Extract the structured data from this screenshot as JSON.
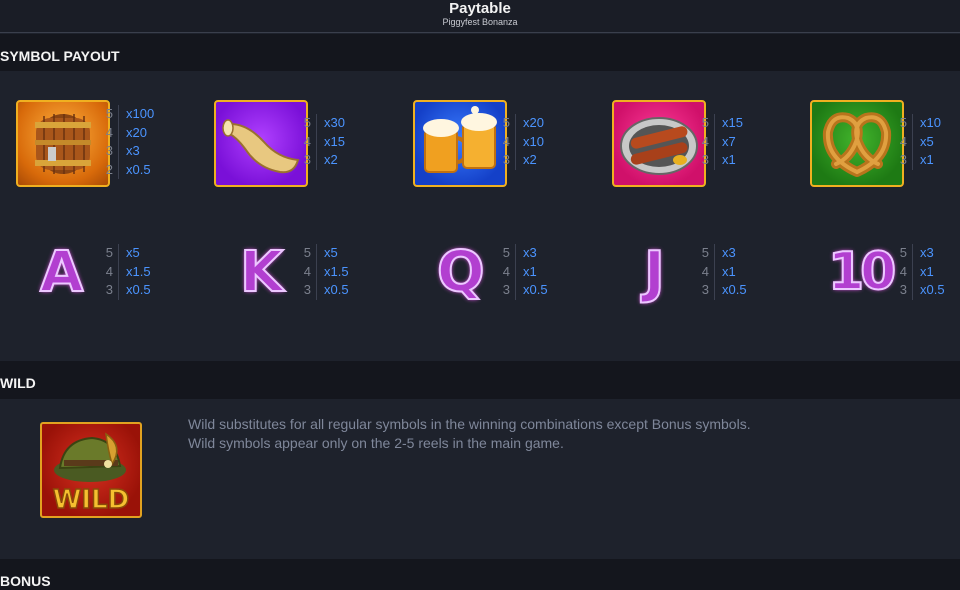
{
  "header": {
    "title": "Paytable",
    "subtitle": "Piggyfest Bonanza"
  },
  "sections": {
    "symbol_payout": "SYMBOL PAYOUT",
    "wild": "WILD",
    "bonus": "BONUS"
  },
  "high_symbols": [
    {
      "name": "barrel",
      "pays": [
        {
          "count": "5",
          "mult": "x100"
        },
        {
          "count": "4",
          "mult": "x20"
        },
        {
          "count": "3",
          "mult": "x3"
        },
        {
          "count": "2",
          "mult": "x0.5"
        }
      ]
    },
    {
      "name": "horn",
      "pays": [
        {
          "count": "5",
          "mult": "x30"
        },
        {
          "count": "4",
          "mult": "x15"
        },
        {
          "count": "3",
          "mult": "x2"
        }
      ]
    },
    {
      "name": "beer",
      "pays": [
        {
          "count": "5",
          "mult": "x20"
        },
        {
          "count": "4",
          "mult": "x10"
        },
        {
          "count": "3",
          "mult": "x2"
        }
      ]
    },
    {
      "name": "sausages",
      "pays": [
        {
          "count": "5",
          "mult": "x15"
        },
        {
          "count": "4",
          "mult": "x7"
        },
        {
          "count": "3",
          "mult": "x1"
        }
      ]
    },
    {
      "name": "pretzel",
      "pays": [
        {
          "count": "5",
          "mult": "x10"
        },
        {
          "count": "4",
          "mult": "x5"
        },
        {
          "count": "3",
          "mult": "x1"
        }
      ]
    }
  ],
  "low_symbols": [
    {
      "letter": "A",
      "pays": [
        {
          "count": "5",
          "mult": "x5"
        },
        {
          "count": "4",
          "mult": "x1.5"
        },
        {
          "count": "3",
          "mult": "x0.5"
        }
      ]
    },
    {
      "letter": "K",
      "pays": [
        {
          "count": "5",
          "mult": "x5"
        },
        {
          "count": "4",
          "mult": "x1.5"
        },
        {
          "count": "3",
          "mult": "x0.5"
        }
      ]
    },
    {
      "letter": "Q",
      "pays": [
        {
          "count": "5",
          "mult": "x3"
        },
        {
          "count": "4",
          "mult": "x1"
        },
        {
          "count": "3",
          "mult": "x0.5"
        }
      ]
    },
    {
      "letter": "J",
      "pays": [
        {
          "count": "5",
          "mult": "x3"
        },
        {
          "count": "4",
          "mult": "x1"
        },
        {
          "count": "3",
          "mult": "x0.5"
        }
      ]
    },
    {
      "letter": "10",
      "pays": [
        {
          "count": "5",
          "mult": "x3"
        },
        {
          "count": "4",
          "mult": "x1"
        },
        {
          "count": "3",
          "mult": "x0.5"
        }
      ]
    }
  ],
  "wild": {
    "label": "WILD",
    "desc_line1": "Wild substitutes for all regular symbols in the winning combinations except Bonus symbols.",
    "desc_line2": "Wild symbols appear only on the 2-5 reels in the main game."
  }
}
